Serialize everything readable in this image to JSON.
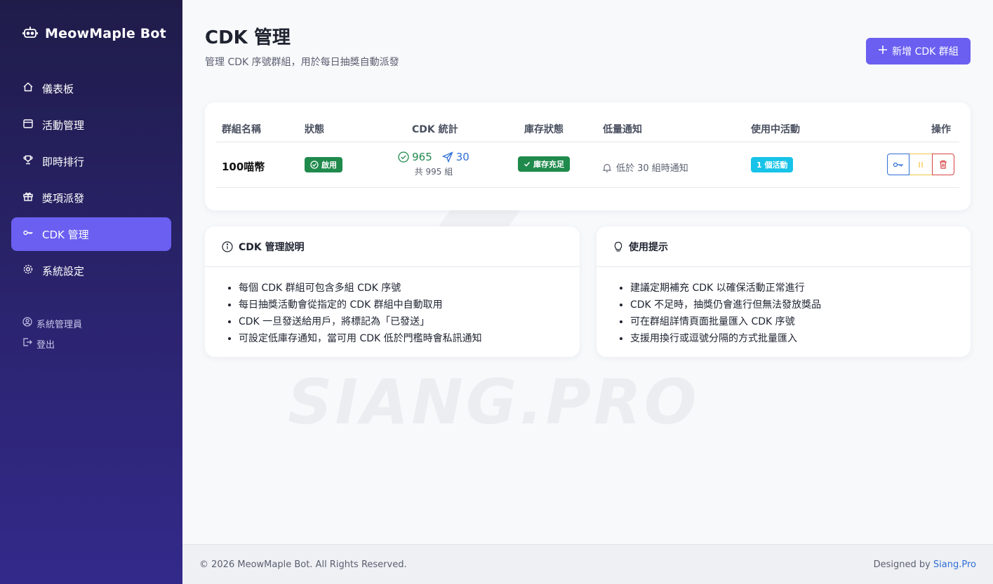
{
  "brand": {
    "name": "MeowMaple Bot",
    "icon": "robot-icon"
  },
  "sidebar": {
    "items": [
      {
        "label": "儀表板",
        "icon": "home-icon",
        "active": false
      },
      {
        "label": "活動管理",
        "icon": "calendar-icon",
        "active": false
      },
      {
        "label": "即時排行",
        "icon": "trophy-icon",
        "active": false
      },
      {
        "label": "獎項派發",
        "icon": "gift-icon",
        "active": false
      },
      {
        "label": "CDK 管理",
        "icon": "key-icon",
        "active": true
      },
      {
        "label": "系統設定",
        "icon": "gear-icon",
        "active": false
      }
    ],
    "user": {
      "name": "系統管理員",
      "logout": "登出"
    }
  },
  "header": {
    "title": "CDK 管理",
    "subtitle": "管理 CDK 序號群組，用於每日抽獎自動派發",
    "add_button": "新增 CDK 群組"
  },
  "table": {
    "columns": [
      "群組名稱",
      "狀態",
      "CDK 統計",
      "庫存狀態",
      "低量通知",
      "使用中活動",
      "操作"
    ],
    "rows": [
      {
        "name": "100喵幣",
        "status": "啟用",
        "available": "965",
        "sent": "30",
        "total": "共 995 組",
        "stock": "庫存充足",
        "low_notice": "低於 30 組時通知",
        "active_events": "1 個活動"
      }
    ]
  },
  "info": {
    "title": "CDK 管理說明",
    "items": [
      "每個 CDK 群組可包含多組 CDK 序號",
      "每日抽獎活動會從指定的 CDK 群組中自動取用",
      "CDK 一旦發送給用戶，將標記為「已發送」",
      "可設定低庫存通知，當可用 CDK 低於門檻時會私訊通知"
    ]
  },
  "tips": {
    "title": "使用提示",
    "items": [
      "建議定期補充 CDK 以確保活動正常進行",
      "CDK 不足時，抽獎仍會進行但無法發放獎品",
      "可在群組詳情頁面批量匯入 CDK 序號",
      "支援用換行或逗號分隔的方式批量匯入"
    ]
  },
  "watermark": "SIANG.PRO",
  "footer": {
    "copyright": "© 2026 MeowMaple Bot. All Rights Reserved.",
    "designed_by": "Designed by",
    "designer": "Siang.Pro"
  },
  "colors": {
    "accent": "#6a5ff0",
    "success": "#1f8a4c",
    "info": "#17c3e8",
    "primary_link": "#2f6fd6",
    "danger": "#d64545",
    "warning": "#f3c64b"
  }
}
